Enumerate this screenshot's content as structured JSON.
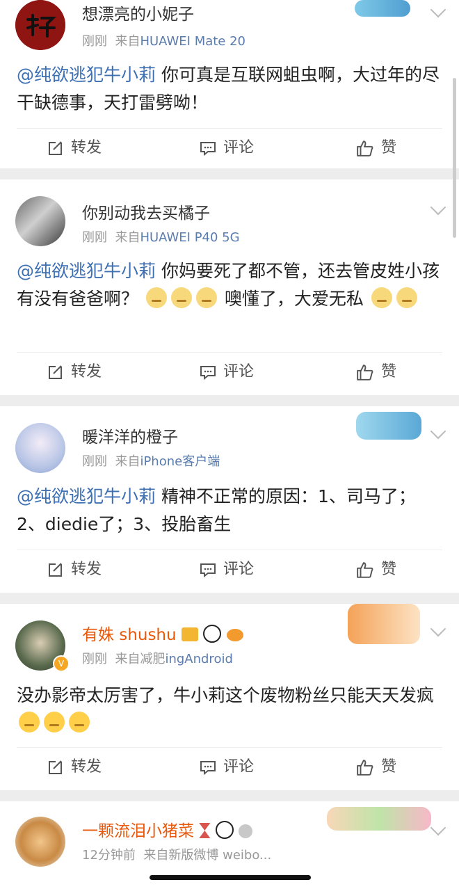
{
  "actions": {
    "repost": "转发",
    "comment": "评论",
    "like": "赞"
  },
  "posts": [
    {
      "username": "想漂亮的小妮子",
      "time": "刚刚",
      "from": "来自",
      "source": "HUAWEI Mate 20",
      "mention": "@纯欲逃犯牛小莉",
      "text": " 你可真是互联网蛆虫啊，大过年的尽干缺德事，天打雷劈呦！"
    },
    {
      "username": "你别动我去买橘子",
      "time": "刚刚",
      "from": "来自",
      "source": "HUAWEI P40 5G",
      "mention": "@纯欲逃犯牛小莉",
      "text": " 你妈要死了都不管，还去管皮姓小孩有没有爸爸啊？",
      "text_after_emoji": "噢懂了，大爱无私"
    },
    {
      "username": "暖洋洋的橙子",
      "time": "刚刚",
      "from": "来自",
      "source": "iPhone客户端",
      "mention": "@纯欲逃犯牛小莉",
      "text": " 精神不正常的原因：1、司马了；2、diedie了；3、投胎畜生"
    },
    {
      "username": "有姝 shushu",
      "time": "刚刚",
      "from": "来自减肥",
      "source": "ingAndroid",
      "text": "没办影帝太厉害了，牛小莉这个废物粉丝只能天天发疯"
    },
    {
      "username": "一颗流泪小猪菜",
      "time": "12分钟前",
      "from": "来自新版微博",
      "source": "weibo..."
    }
  ],
  "colors": {
    "mention": "#3d6fb3",
    "vip_name": "#e8590c",
    "meta": "#999999",
    "separator": "#ededed"
  }
}
